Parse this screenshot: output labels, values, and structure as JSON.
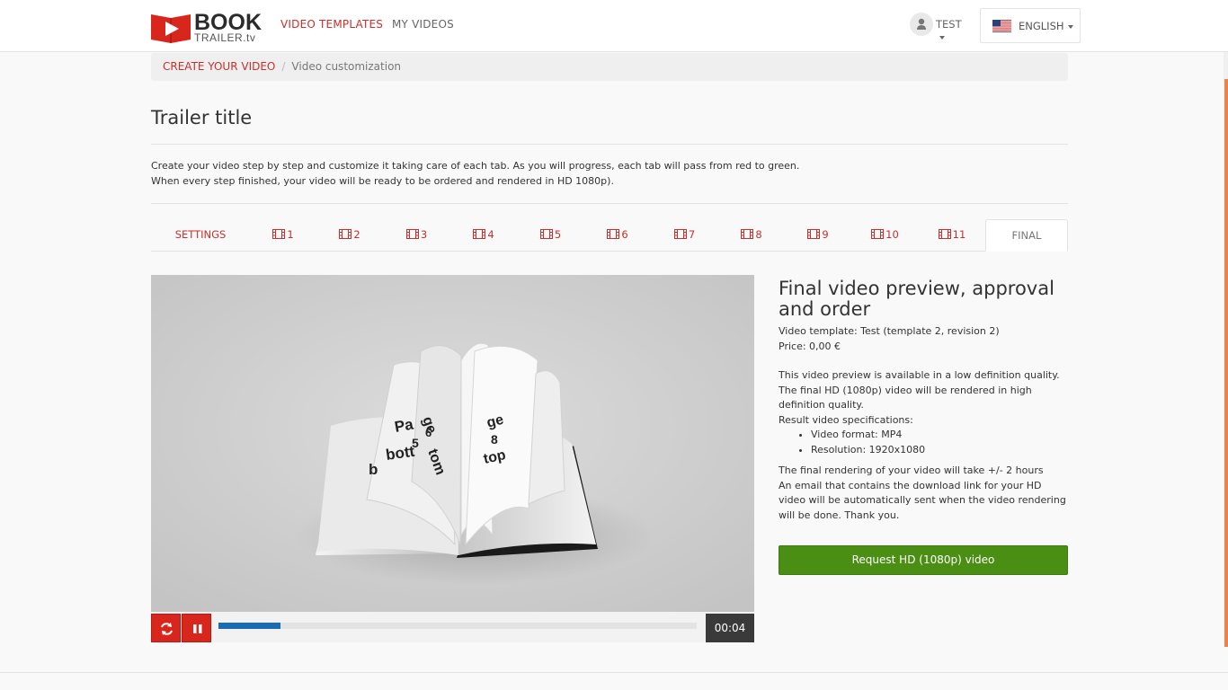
{
  "header": {
    "logo": {
      "top": "BOOK",
      "bottom": "TRAILER.tv"
    },
    "nav": [
      {
        "label": "VIDEO TEMPLATES",
        "active": true
      },
      {
        "label": "MY VIDEOS",
        "active": false
      }
    ],
    "user": {
      "name": "TEST",
      "icon": "user-icon"
    },
    "language": {
      "label": "ENGLISH",
      "icon": "us-flag-icon"
    }
  },
  "breadcrumb": {
    "link": "CREATE YOUR VIDEO",
    "separator": "/",
    "current": "Video customization"
  },
  "page": {
    "title": "Trailer title",
    "intro_line1": "Create your video step by step and customize it taking care of each tab. As you will progress, each tab will pass from red to green.",
    "intro_line2": "When every step finished, your video will be ready to be ordered and rendered in HD 1080p)."
  },
  "tabs": [
    {
      "label": "SETTINGS",
      "icon": ""
    },
    {
      "label": "1",
      "icon": "film-icon"
    },
    {
      "label": "2",
      "icon": "film-icon"
    },
    {
      "label": "3",
      "icon": "film-icon"
    },
    {
      "label": "4",
      "icon": "film-icon"
    },
    {
      "label": "5",
      "icon": "film-icon"
    },
    {
      "label": "6",
      "icon": "film-icon"
    },
    {
      "label": "7",
      "icon": "film-icon"
    },
    {
      "label": "8",
      "icon": "film-icon"
    },
    {
      "label": "9",
      "icon": "film-icon"
    },
    {
      "label": "10",
      "icon": "film-icon"
    },
    {
      "label": "11",
      "icon": "film-icon"
    },
    {
      "label": "FINAL",
      "icon": "",
      "active": true
    }
  ],
  "player": {
    "book_text_left_1": "Pa",
    "book_text_left_2": "5",
    "book_text_left_3": "bott",
    "book_text_left_4": "b",
    "book_text_mid_1": "ge",
    "book_text_mid_2": "6",
    "book_text_mid_3": "tom",
    "book_text_right_1": "ge",
    "book_text_right_2": "8",
    "book_text_right_3": "top",
    "progress": 0.13,
    "time": "00:04",
    "replay_icon": "refresh-icon",
    "pause_icon": "pause-icon"
  },
  "final": {
    "heading": "Final video preview, approval and order",
    "template_line": "Video template: Test (template 2, revision 2)",
    "price_line": "Price: 0,00 €",
    "preview_note": "This video preview is available in a low definition quality. The final HD (1080p) video will be rendered in high definition quality.",
    "specs_title": "Result video specifications:",
    "specs": [
      "Video format: MP4",
      "Resolution: 1920x1080"
    ],
    "render_time": "The final rendering of your video will take +/- 2 hours",
    "email_note": "An email that contains the download link for your HD video will be automatically sent when the video rendering will be done. Thank you.",
    "request_button": "Request HD (1080p) video"
  },
  "colors": {
    "accent_red": "#c9302c",
    "button_green": "#4a8f13",
    "progress_blue": "#1a6db0"
  }
}
